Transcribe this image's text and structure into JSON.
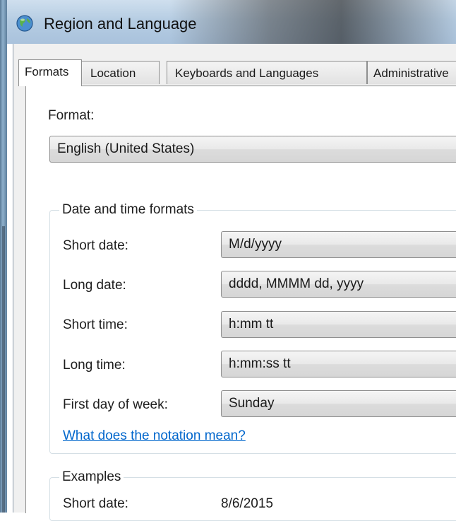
{
  "window": {
    "title": "Region and Language",
    "icon": "globe-icon"
  },
  "tabs": [
    {
      "label": "Formats",
      "active": true
    },
    {
      "label": "Location",
      "active": false
    },
    {
      "label": "Keyboards and Languages",
      "active": false
    },
    {
      "label": "Administrative",
      "active": false
    }
  ],
  "format": {
    "label": "Format:",
    "selected": "English (United States)"
  },
  "date_time_formats": {
    "group_label": "Date and time formats",
    "rows": [
      {
        "label": "Short date:",
        "value": "M/d/yyyy"
      },
      {
        "label": "Long date:",
        "value": "dddd, MMMM dd, yyyy"
      },
      {
        "label": "Short time:",
        "value": "h:mm tt"
      },
      {
        "label": "Long time:",
        "value": "h:mm:ss tt"
      },
      {
        "label": "First day of week:",
        "value": "Sunday"
      }
    ],
    "help_link": "What does the notation mean?"
  },
  "examples": {
    "group_label": "Examples",
    "rows": [
      {
        "label": "Short date:",
        "value": "8/6/2015"
      }
    ]
  },
  "colors": {
    "link": "#0066cc",
    "panel_background": "#ffffff",
    "dialog_background": "#f0f0f0"
  }
}
